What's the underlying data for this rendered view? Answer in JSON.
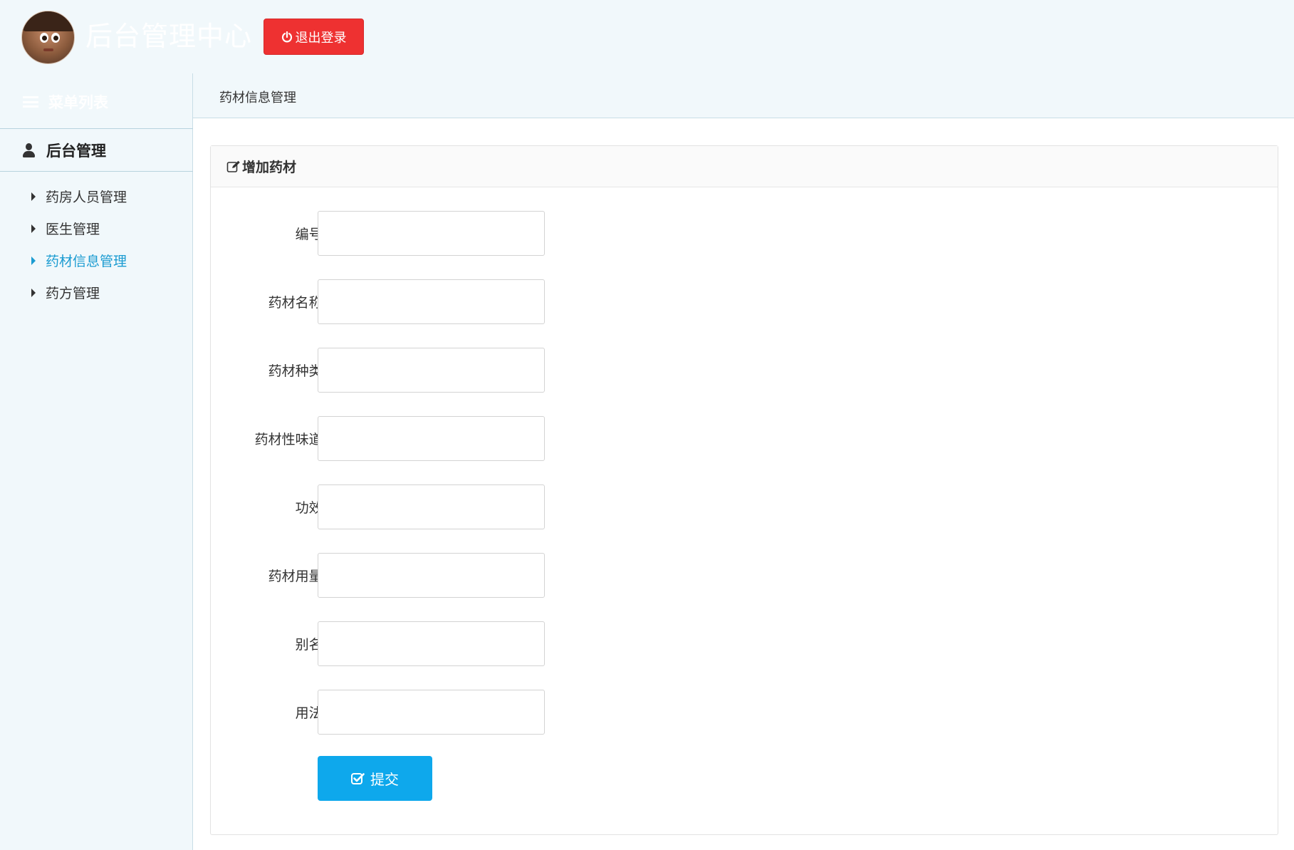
{
  "header": {
    "title": "后台管理中心",
    "logout_label": "退出登录"
  },
  "sidebar": {
    "menu_title": "菜单列表",
    "group_label": "后台管理",
    "items": [
      {
        "label": "药房人员管理"
      },
      {
        "label": "医生管理"
      },
      {
        "label": "药材信息管理"
      },
      {
        "label": "药方管理"
      }
    ]
  },
  "tabs": {
    "current": "药材信息管理"
  },
  "panel": {
    "heading": "增加药材",
    "fields": [
      {
        "label": "编号:",
        "value": ""
      },
      {
        "label": "药材名称:",
        "value": ""
      },
      {
        "label": "药材种类:",
        "value": ""
      },
      {
        "label": "药材性味道:",
        "value": ""
      },
      {
        "label": "功效:",
        "value": ""
      },
      {
        "label": "药材用量:",
        "value": ""
      },
      {
        "label": "别名:",
        "value": ""
      },
      {
        "label": "用法:",
        "value": ""
      }
    ],
    "submit_label": "提交"
  },
  "colors": {
    "logout_bg": "#ee3131",
    "submit_bg": "#0ea8ec",
    "active_nav": "#1a9bd1",
    "page_bg": "#f1f8fb"
  },
  "icons": [
    "power-icon",
    "list-icon",
    "user-icon",
    "caret-right-icon",
    "edit-icon",
    "check-square-icon"
  ]
}
